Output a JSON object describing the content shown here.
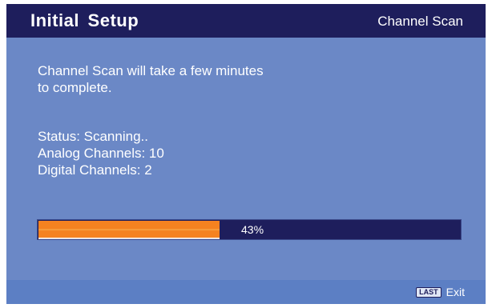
{
  "header": {
    "title": "Initial  Setup",
    "subtitle": "Channel Scan"
  },
  "message": {
    "line1": "Channel Scan will take a few minutes",
    "line2": "to complete."
  },
  "status": {
    "status_line": "Status: Scanning..",
    "analog_line": "Analog Channels: 10",
    "digital_line": "Digital Channels: 2"
  },
  "progress": {
    "percent": 43,
    "label": "43%"
  },
  "footer": {
    "key_label": "LAST",
    "action_label": "Exit"
  },
  "colors": {
    "header_bg": "#1e1e5c",
    "panel_bg": "#6b88c6",
    "progress_fill": "#f58220"
  }
}
